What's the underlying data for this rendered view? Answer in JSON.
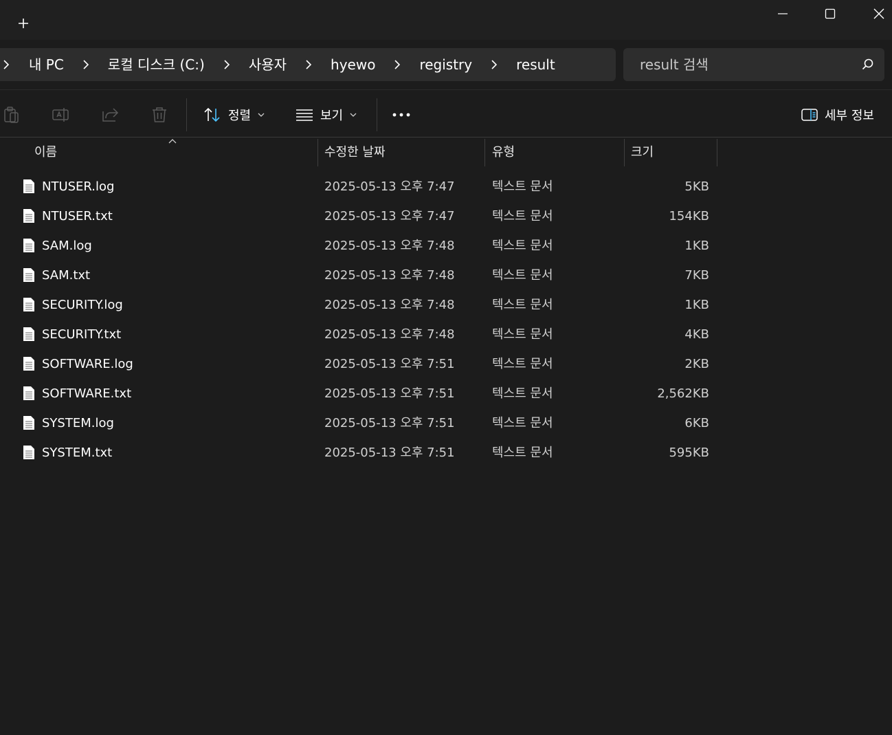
{
  "window": {
    "new_tab_icon": "plus-icon",
    "controls": [
      "minimize-icon",
      "maximize-icon",
      "close-icon"
    ]
  },
  "breadcrumb": {
    "items": [
      "내 PC",
      "로컬 디스크 (C:)",
      "사용자",
      "hyewo",
      "registry",
      "result"
    ]
  },
  "search": {
    "placeholder": "result 검색"
  },
  "toolbar": {
    "sort_label": "정렬",
    "view_label": "보기",
    "details_label": "세부 정보",
    "icons": [
      "copy-icon",
      "rename-icon",
      "share-icon",
      "delete-icon",
      "sort-icon",
      "view-icon",
      "more-icon",
      "details-pane-icon"
    ]
  },
  "columns": {
    "name": "이름",
    "modified": "수정한 날짜",
    "type": "유형",
    "size": "크기"
  },
  "files": [
    {
      "name": "NTUSER.log",
      "modified": "2025-05-13 오후 7:47",
      "type": "텍스트 문서",
      "size": "5KB"
    },
    {
      "name": "NTUSER.txt",
      "modified": "2025-05-13 오후 7:47",
      "type": "텍스트 문서",
      "size": "154KB"
    },
    {
      "name": "SAM.log",
      "modified": "2025-05-13 오후 7:48",
      "type": "텍스트 문서",
      "size": "1KB"
    },
    {
      "name": "SAM.txt",
      "modified": "2025-05-13 오후 7:48",
      "type": "텍스트 문서",
      "size": "7KB"
    },
    {
      "name": "SECURITY.log",
      "modified": "2025-05-13 오후 7:48",
      "type": "텍스트 문서",
      "size": "1KB"
    },
    {
      "name": "SECURITY.txt",
      "modified": "2025-05-13 오후 7:48",
      "type": "텍스트 문서",
      "size": "4KB"
    },
    {
      "name": "SOFTWARE.log",
      "modified": "2025-05-13 오후 7:51",
      "type": "텍스트 문서",
      "size": "2KB"
    },
    {
      "name": "SOFTWARE.txt",
      "modified": "2025-05-13 오후 7:51",
      "type": "텍스트 문서",
      "size": "2,562KB"
    },
    {
      "name": "SYSTEM.log",
      "modified": "2025-05-13 오후 7:51",
      "type": "텍스트 문서",
      "size": "6KB"
    },
    {
      "name": "SYSTEM.txt",
      "modified": "2025-05-13 오후 7:51",
      "type": "텍스트 문서",
      "size": "595KB"
    }
  ],
  "colors": {
    "background": "#1c1c1c",
    "titlebar": "#202020",
    "field": "#2d2d2d",
    "accent": "#4cc2ff"
  }
}
